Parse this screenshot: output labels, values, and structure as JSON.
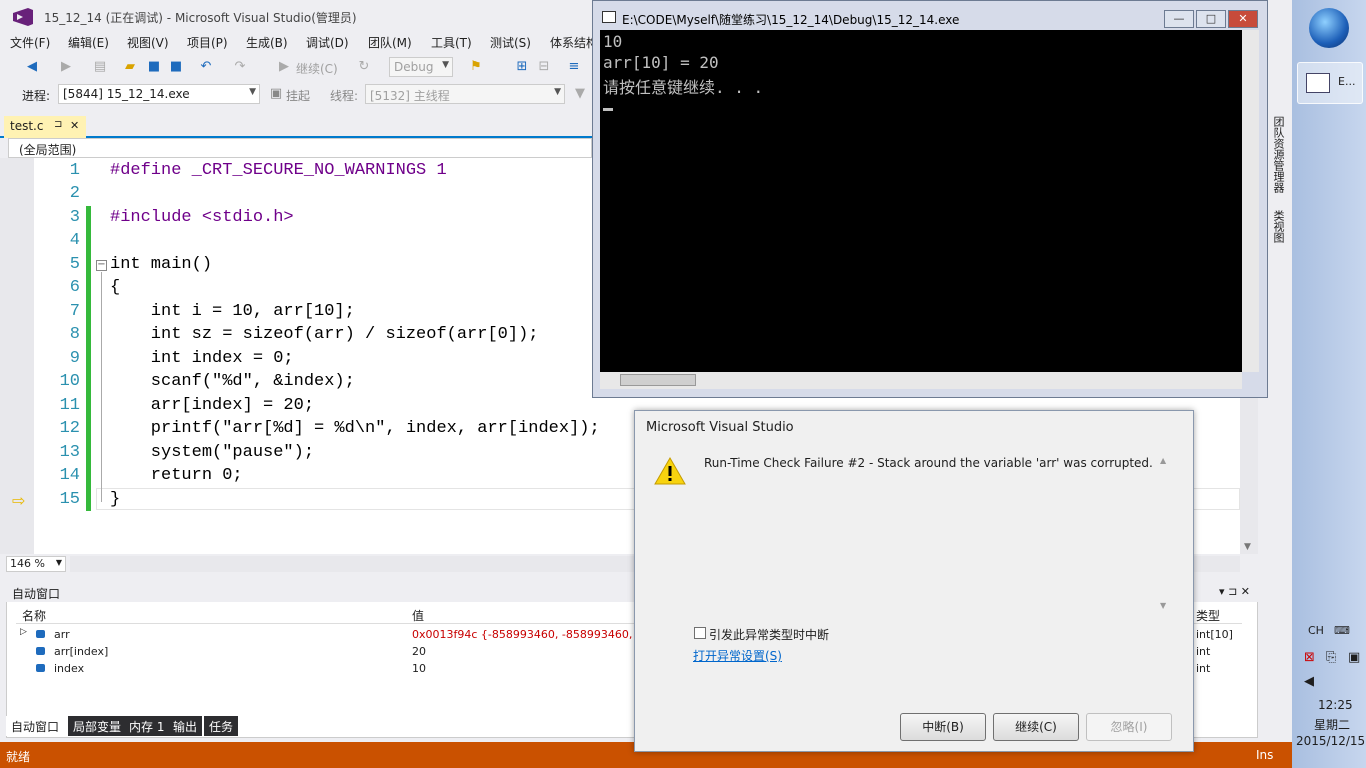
{
  "vs": {
    "title": "15_12_14 (正在调试) - Microsoft Visual Studio(管理员)",
    "menu": [
      "文件(F)",
      "编辑(E)",
      "视图(V)",
      "项目(P)",
      "生成(B)",
      "调试(D)",
      "团队(M)",
      "工具(T)",
      "测试(S)",
      "体系结构"
    ],
    "toolbar": {
      "continue_label": "继续(C)",
      "config": "Debug"
    },
    "debugbar": {
      "process_label": "进程:",
      "process_value": "[5844] 15_12_14.exe",
      "suspend_label": "挂起",
      "thread_label": "线程:",
      "thread_value": "[5132] 主线程"
    },
    "tab": {
      "label": "test.c",
      "pin": "⊐",
      "close": "✕"
    },
    "scope": "(全局范围)",
    "zoom": "146 %",
    "code_lines": [
      {
        "n": "1",
        "text": "#define _CRT_SECURE_NO_WARNINGS 1"
      },
      {
        "n": "2",
        "text": ""
      },
      {
        "n": "3",
        "text": "#include <stdio.h>"
      },
      {
        "n": "4",
        "text": ""
      },
      {
        "n": "5",
        "text": "int main()"
      },
      {
        "n": "6",
        "text": "{"
      },
      {
        "n": "7",
        "text": "    int i = 10, arr[10];"
      },
      {
        "n": "8",
        "text": "    int sz = sizeof(arr) / sizeof(arr[0]);"
      },
      {
        "n": "9",
        "text": "    int index = 0;"
      },
      {
        "n": "10",
        "text": "    scanf(\"%d\", &index);"
      },
      {
        "n": "11",
        "text": "    arr[index] = 20;"
      },
      {
        "n": "12",
        "text": "    printf(\"arr[%d] = %d\\n\", index, arr[index]);"
      },
      {
        "n": "13",
        "text": "    system(\"pause\");"
      },
      {
        "n": "14",
        "text": "    return 0;"
      },
      {
        "n": "15",
        "text": "}"
      }
    ],
    "autos": {
      "title": "自动窗口",
      "col_name": "名称",
      "col_value": "值",
      "col_type": "类型",
      "rows": [
        {
          "name": "arr",
          "value": "0x0013f94c {-858993460, -858993460, -8589",
          "type": "int[10]",
          "value_color": "#c80000"
        },
        {
          "name": "arr[index]",
          "value": "20",
          "type": "int",
          "value_color": "#1e1e1e"
        },
        {
          "name": "index",
          "value": "10",
          "type": "int",
          "value_color": "#1e1e1e"
        }
      ],
      "panel_ctrls": "▾ ⊐ ✕"
    },
    "bottom_tabs": [
      "自动窗口",
      "局部变量",
      "内存 1",
      "输出",
      "任务"
    ],
    "status_left": "就绪",
    "status_right": "Ins",
    "side_tabs": [
      "团队资源管理器",
      "类视图"
    ]
  },
  "console": {
    "title": "E:\\CODE\\Myself\\随堂练习\\15_12_14\\Debug\\15_12_14.exe",
    "lines": [
      "10",
      "arr[10] = 20",
      "请按任意键继续. . ."
    ],
    "btn_min": "—",
    "btn_max": "□",
    "btn_close": "✕"
  },
  "dialog": {
    "title": "Microsoft Visual Studio",
    "message": "Run-Time Check Failure #2 - Stack around the variable 'arr' was corrupted.",
    "checkbox_label": "引发此异常类型时中断",
    "link": "打开异常设置(S)",
    "btn_break": "中断(B)",
    "btn_continue": "继续(C)",
    "btn_ignore": "忽略(I)"
  },
  "taskbar": {
    "app_label": "E...",
    "ime": "CH",
    "time": "12:25",
    "weekday": "星期二",
    "date": "2015/12/15"
  }
}
